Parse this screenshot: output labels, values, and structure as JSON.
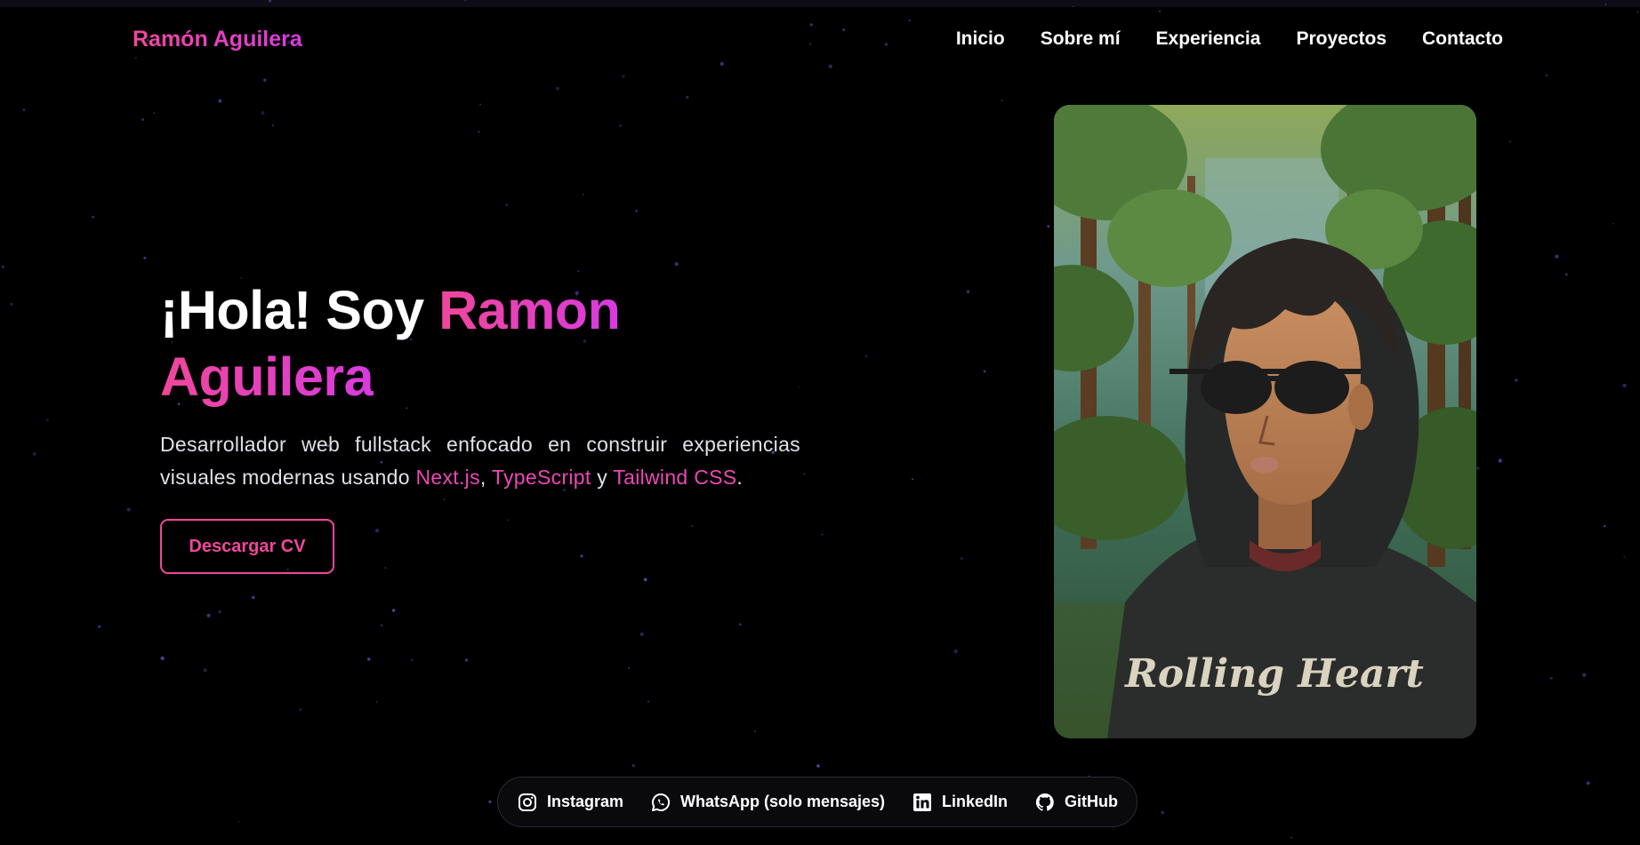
{
  "nav": {
    "brand": "Ramón Aguilera",
    "links": [
      "Inicio",
      "Sobre mí",
      "Experiencia",
      "Proyectos",
      "Contacto"
    ]
  },
  "hero": {
    "greeting": "¡Hola! Soy ",
    "name_first": "Ramon",
    "name_last": "Aguilera",
    "desc_pre": "Desarrollador web fullstack enfocado en construir experiencias visuales modernas usando ",
    "tech1": "Next.js",
    "sep1": ", ",
    "tech2": "TypeScript",
    "sep2": " y ",
    "tech3": "Tailwind CSS",
    "desc_end": ".",
    "cv_button": "Descargar CV"
  },
  "portrait": {
    "shirt_text": "Rolling Heart"
  },
  "socials": [
    {
      "label": "Instagram",
      "icon": "instagram-icon"
    },
    {
      "label": "WhatsApp (solo mensajes)",
      "icon": "whatsapp-icon"
    },
    {
      "label": "LinkedIn",
      "icon": "linkedin-icon"
    },
    {
      "label": "GitHub",
      "icon": "github-icon"
    }
  ],
  "colors": {
    "accent_pink": "#f0479a",
    "accent_magenta": "#d93ae0",
    "background": "#000000"
  }
}
